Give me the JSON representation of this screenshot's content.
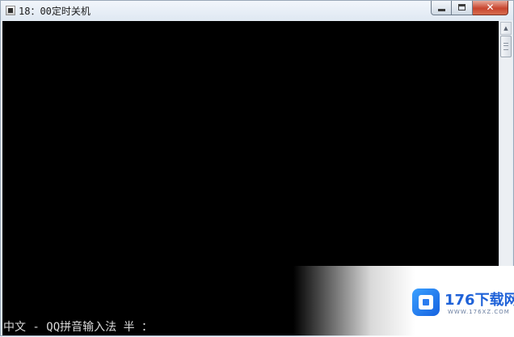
{
  "window": {
    "title": "18：00定时关机"
  },
  "console": {
    "ime_status": "中文 - QQ拼音输入法 半 ："
  },
  "scrollbar": {
    "up_arrow": "▲",
    "down_arrow": "▼"
  },
  "caption": {
    "close_glyph": "✕"
  },
  "watermark": {
    "brand": "176下载网",
    "url": "WWW.176XZ.COM"
  },
  "colors": {
    "console_bg": "#000000",
    "console_text": "#d9d9d9",
    "close_button": "#c8452e",
    "brand_blue": "#1f62d8"
  },
  "icons": {
    "app": "console-app-icon",
    "minimize": "minimize-icon",
    "maximize": "maximize-icon",
    "close": "close-icon",
    "logo": "176xz-logo-icon"
  }
}
